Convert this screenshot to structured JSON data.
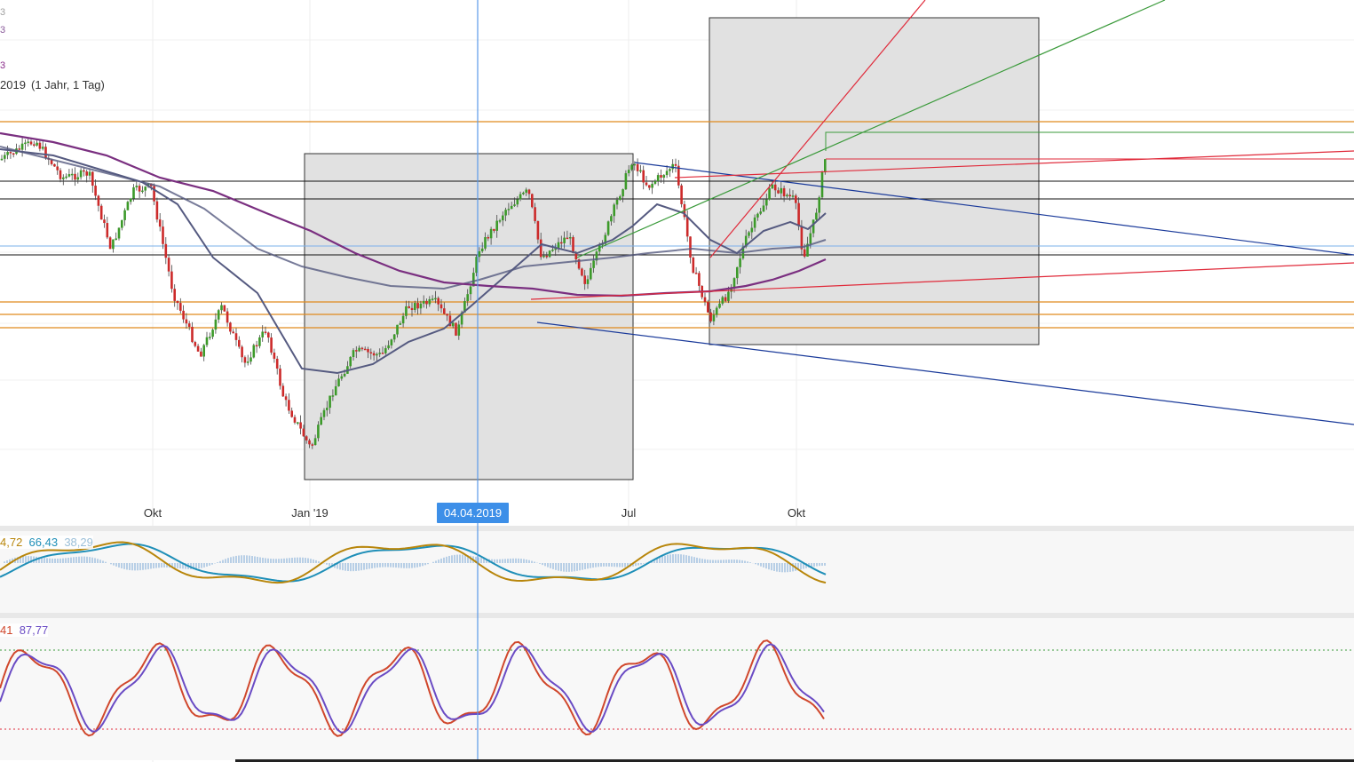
{
  "chart_data": {
    "type": "candlestick",
    "period_label": "2019",
    "range_label": "(1 Jahr, 1 Tag)",
    "top_legend_fragments": [
      "3",
      "3",
      "3"
    ],
    "x_ticks": [
      "Okt",
      "Jan '19",
      "Jul",
      "Okt"
    ],
    "cursor_date": "04.04.2019",
    "indicators": {
      "macd": {
        "values": [
          "4,72",
          "66,43",
          "38,29"
        ],
        "colors": [
          "#b8860b",
          "#1f8fb8",
          "#9bbfd8"
        ]
      },
      "stochastic": {
        "values": [
          "41",
          "87,77"
        ],
        "colors": [
          "#d0472c",
          "#6a4bc4"
        ]
      }
    },
    "colors": {
      "up": "#3c9a2a",
      "down": "#cc2a2a",
      "ma_fast": "#555a80",
      "ma_slow": "#7a2f80",
      "orange_levels": "#e08a1e",
      "blue_channel": "#1a3a9a",
      "red_trend": "#e02a3a",
      "green_trend": "#3a9a3a",
      "cursor": "#5a9ae8",
      "box_fill": "#e1e1e1"
    }
  }
}
